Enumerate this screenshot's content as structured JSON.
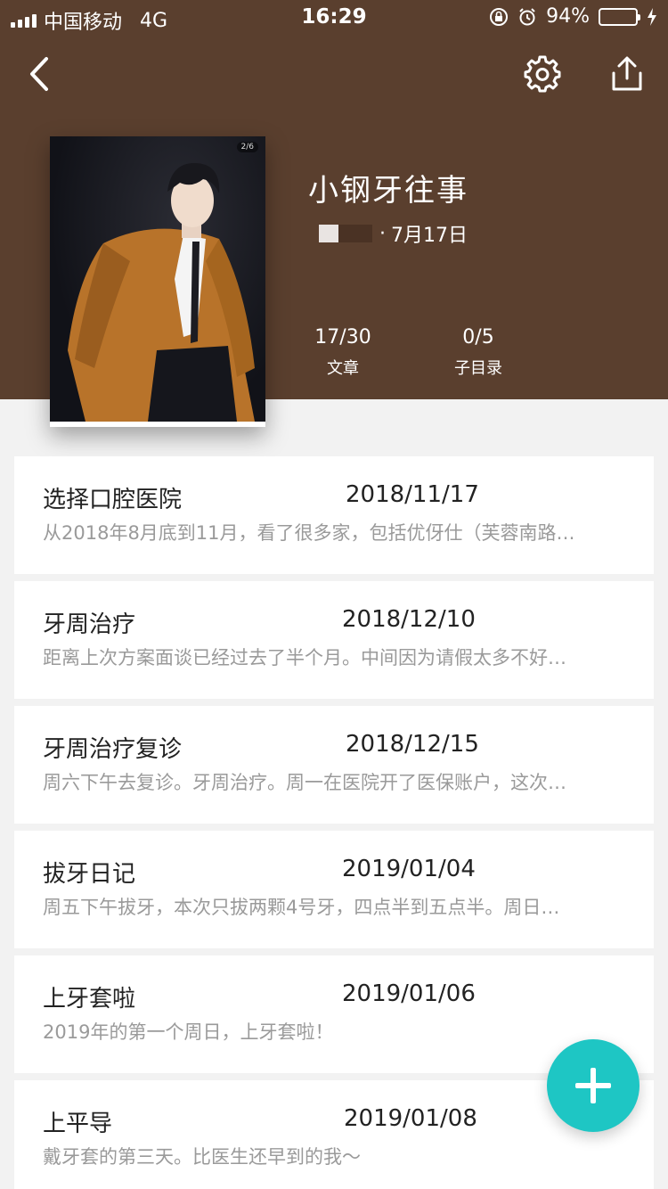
{
  "status_bar": {
    "carrier": "中国移动",
    "network": "4G",
    "time": "16:29",
    "battery_percent": "94%",
    "battery_level": 0.94,
    "icons": [
      "signal-icon",
      "orientation-lock-icon",
      "alarm-icon",
      "battery-icon",
      "charging-icon"
    ]
  },
  "nav": {
    "icons": [
      "back-icon",
      "gear-icon",
      "share-icon"
    ]
  },
  "header": {
    "background_color": "#5a3f2e",
    "cover_badge": "2/6",
    "title": "小钢牙往事",
    "date": "7月17日",
    "stats": [
      {
        "value": "17/30",
        "label": "文章"
      },
      {
        "value": "0/5",
        "label": "子目录"
      }
    ]
  },
  "articles": [
    {
      "title": "选择口腔医院",
      "date": "2018/11/17",
      "summary": "从2018年8月底到11月，看了很多家，包括优伢仕（芙蓉南路…"
    },
    {
      "title": "牙周治疗",
      "date": "2018/12/10",
      "summary": "距离上次方案面谈已经过去了半个月。中间因为请假太多不好…"
    },
    {
      "title": "牙周治疗复诊",
      "date": "2018/12/15",
      "summary": "周六下午去复诊。牙周治疗。周一在医院开了医保账户，这次…"
    },
    {
      "title": "拔牙日记",
      "date": "2019/01/04",
      "summary": "周五下午拔牙，本次只拔两颗4号牙，四点半到五点半。周日…"
    },
    {
      "title": "上牙套啦",
      "date": "2019/01/06",
      "summary": "2019年的第一个周日，上牙套啦！"
    },
    {
      "title": "上平导",
      "date": "2019/01/08",
      "summary": "戴牙套的第三天。比医生还早到的我～"
    }
  ],
  "fab": {
    "icon": "plus-icon",
    "color": "#1ec6c4"
  }
}
